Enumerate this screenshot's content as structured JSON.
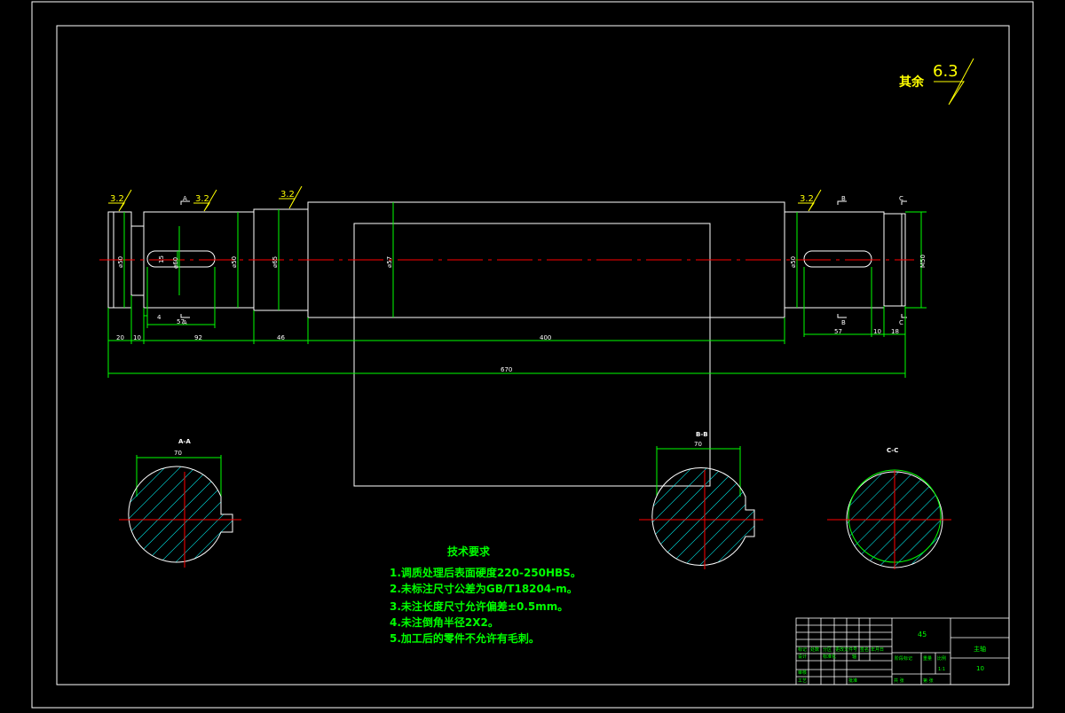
{
  "colors": {
    "background": "#000000",
    "outline": "#ffffff",
    "dimension": "#00ff00",
    "centerline": "#ff0000",
    "hatch": "#00ffff",
    "text": "#00ff00"
  },
  "surface_finish": {
    "prefix": "其余",
    "value": "6.3"
  },
  "roughness_marks": [
    "3.2",
    "3.2",
    "3.2",
    "3.2"
  ],
  "diameters": {
    "d1": "⌀50",
    "d2": "⌀60",
    "d3": "⌀50",
    "d4": "⌀65",
    "d5": "⌀57",
    "d6": "⌀50",
    "d7": "M50",
    "key1": "15"
  },
  "lengths": {
    "l1": "20",
    "l2": "10",
    "l3": "92",
    "l4": "46",
    "l5": "400",
    "l6": "57",
    "l7": "10",
    "l8": "18",
    "total": "670",
    "key_left_len": "57",
    "key_left_offset": "4"
  },
  "sections": {
    "a": {
      "label": "A-A",
      "width": "70"
    },
    "b": {
      "label": "B-B",
      "width": "70"
    },
    "c": {
      "label": "C-C"
    }
  },
  "cut_marks": [
    "A",
    "B",
    "C",
    "A",
    "B",
    "C"
  ],
  "requirements": {
    "title": "技术要求",
    "items": [
      "1.调质处理后表面硬度220-250HBS。",
      "2.未标注尺寸公差为GB/T18204-m。",
      "3.未注长度尺寸允许偏差±0.5mm。",
      "4.未注倒角半径2X2。",
      "5.加工后的零件不允许有毛刺。"
    ]
  },
  "title_block": {
    "part_name": "轴",
    "material": "45",
    "drawing_no": "主轴",
    "scale": "1:1",
    "weight": "10",
    "labels": [
      "标记",
      "处数",
      "分区",
      "更改文件号",
      "签名",
      "年月日",
      "设计",
      "标准化",
      "阶段标记",
      "重量",
      "比例",
      "审核",
      "工艺",
      "批准",
      "共 张",
      "第 张"
    ]
  }
}
